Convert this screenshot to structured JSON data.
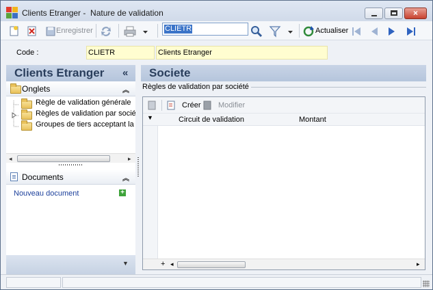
{
  "window": {
    "title": "Clients Etranger -  Nature de validation",
    "buttons": {
      "minimize": "minimize-icon",
      "maximize": "maximize-icon",
      "close": "×"
    }
  },
  "toolbar": {
    "save_label": "Enregistrer",
    "search_value": "CLIETR",
    "refresh_label": "Actualiser",
    "icons": [
      "new-icon",
      "delete-icon",
      "save-icon",
      "sync-icon",
      "print-icon",
      "search-icon",
      "filter-icon",
      "refresh-icon",
      "first-icon",
      "previous-icon",
      "next-icon",
      "last-icon"
    ]
  },
  "record": {
    "code_label": "Code :",
    "code_value": "CLIETR",
    "name_value": "Clients Etranger"
  },
  "left_pane": {
    "title": "Clients Etranger",
    "collapse_glyph": "«",
    "tabs_section": {
      "label": "Onglets",
      "items": [
        {
          "label": "Règle de validation générale"
        },
        {
          "label": "Règles de validation par société"
        },
        {
          "label": "Groupes de tiers acceptant la nature"
        }
      ]
    },
    "documents_section": {
      "label": "Documents",
      "new_document_label": "Nouveau document"
    }
  },
  "right_pane": {
    "title": "Societe",
    "group_label": "Règles de validation par société",
    "grid": {
      "create_label": "Créer",
      "edit_label": "Modifier",
      "columns": [
        "Circuit de validation",
        "Montant"
      ]
    }
  },
  "colors": {
    "pane_header": "#c8d4e6",
    "field_highlight": "#fffdd0",
    "link": "#1b3f9b"
  }
}
